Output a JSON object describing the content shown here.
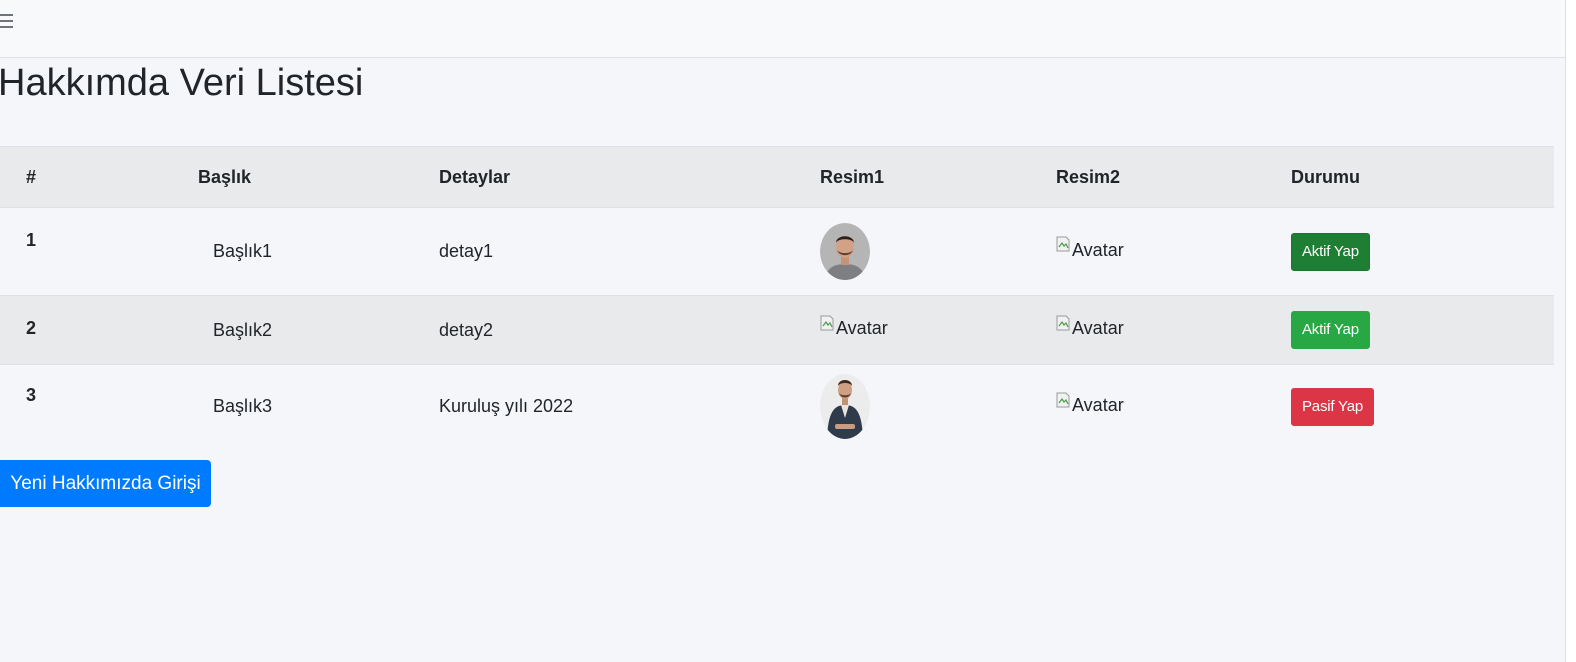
{
  "page_title": "Hakkımda Veri Listesi",
  "table": {
    "headers": {
      "num": "#",
      "title": "Başlık",
      "details": "Detaylar",
      "image1": "Resim1",
      "image2": "Resim2",
      "status": "Durumu"
    },
    "rows": [
      {
        "num": "1",
        "title": "Başlık1",
        "details": "detay1",
        "image1_alt": "",
        "image2_alt": "Avatar",
        "status_button": "Aktif Yap"
      },
      {
        "num": "2",
        "title": "Başlık2",
        "details": "detay2",
        "image1_alt": "Avatar",
        "image2_alt": "Avatar",
        "status_button": "Aktif Yap"
      },
      {
        "num": "3",
        "title": "Başlık3",
        "details": "Kuruluş yılı 2022",
        "image1_alt": "",
        "image2_alt": "Avatar",
        "status_button": "Pasif Yap"
      }
    ]
  },
  "new_entry_button": "Yeni Hakkımızda Girişi",
  "colors": {
    "active_button_pressed": "#1e7e34",
    "active_button": "#28a745",
    "passive_button": "#dc3545",
    "primary_button": "#007bff",
    "table_header_bg": "#e9eaec",
    "page_bg": "#f4f6f9"
  },
  "icons": {
    "menu": "hamburger-menu-icon",
    "broken_image": "broken-image-icon"
  }
}
